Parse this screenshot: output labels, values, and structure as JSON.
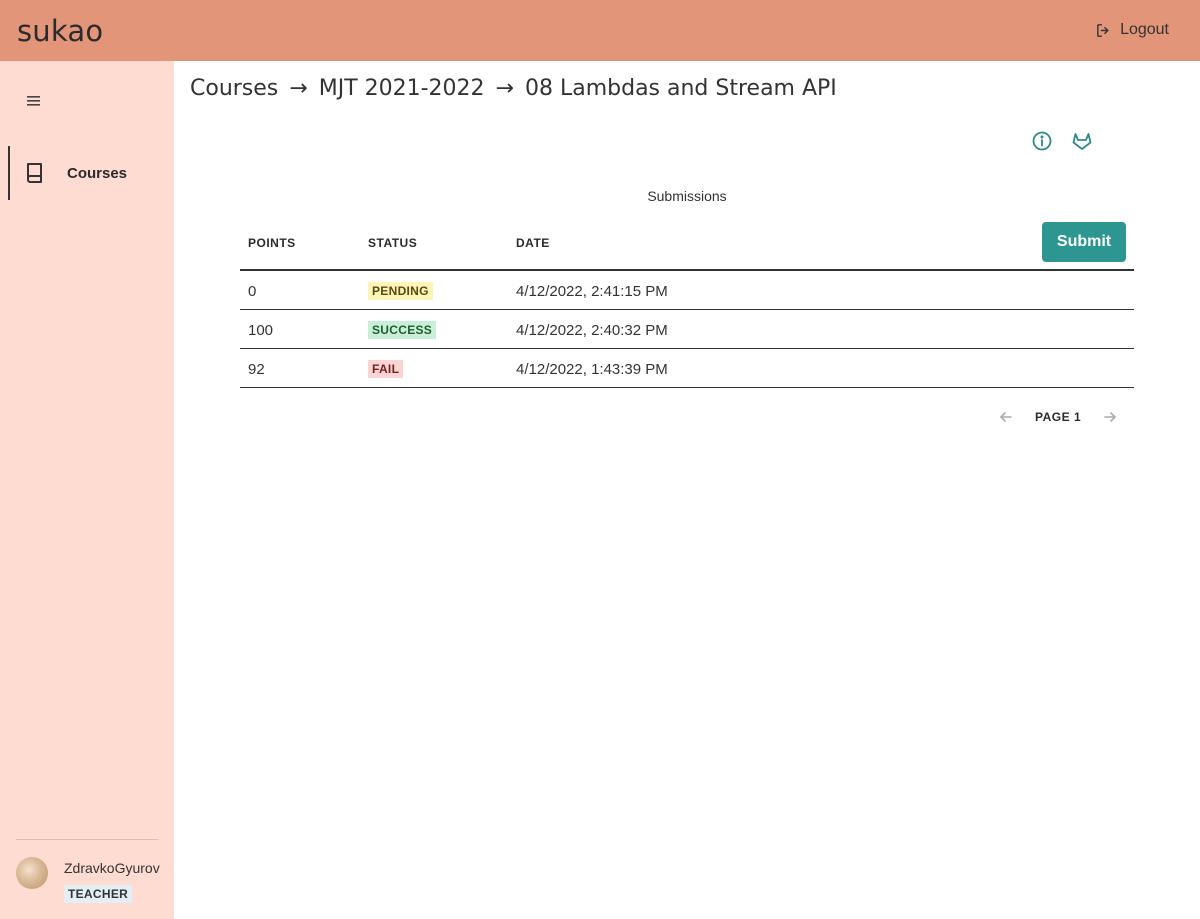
{
  "app": {
    "title": "sukao"
  },
  "header": {
    "logout_label": "Logout",
    "logout_icon": "logout-icon"
  },
  "sidebar": {
    "menu_icon": "hamburger-icon",
    "items": [
      {
        "label": "Courses",
        "icon": "book-icon",
        "active": true
      }
    ],
    "user": {
      "name": "ZdravkoGyurov",
      "role": "TEACHER"
    }
  },
  "breadcrumb": {
    "separator": "→",
    "items": [
      "Courses",
      "MJT 2021-2022",
      "08 Lambdas and Stream API"
    ]
  },
  "actions": {
    "info_icon": "info-icon",
    "gitlab_icon": "gitlab-icon"
  },
  "submissions": {
    "caption": "Submissions",
    "columns": [
      "POINTS",
      "STATUS",
      "DATE"
    ],
    "submit_label": "Submit",
    "rows": [
      {
        "points": "0",
        "status": "PENDING",
        "date": "4/12/2022, 2:41:15 PM"
      },
      {
        "points": "100",
        "status": "SUCCESS",
        "date": "4/12/2022, 2:40:32 PM"
      },
      {
        "points": "92",
        "status": "FAIL",
        "date": "4/12/2022, 1:43:39 PM"
      }
    ]
  },
  "pagination": {
    "label": "PAGE 1",
    "prev_icon": "arrow-left-icon",
    "next_icon": "arrow-right-icon"
  },
  "colors": {
    "topbar": "#e39579",
    "sidebar": "#fedcd2",
    "accent": "#2e9690",
    "pending": "#fdf5b8",
    "success": "#c9f0d6",
    "fail": "#fbd4d4"
  }
}
